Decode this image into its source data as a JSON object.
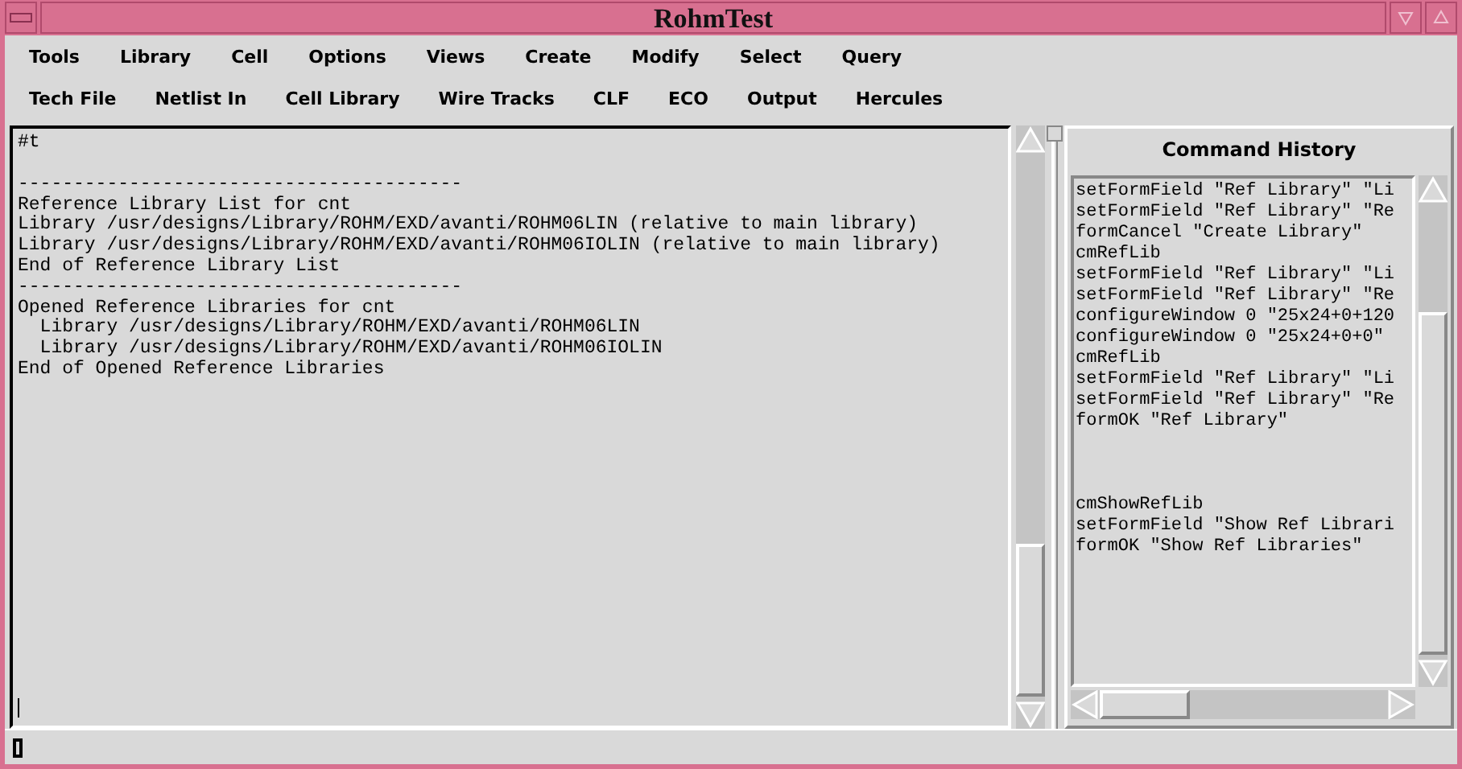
{
  "window": {
    "title": "RohmTest"
  },
  "menus": [
    [
      "Tools",
      "Library",
      "Cell",
      "Options",
      "Views",
      "Create",
      "Modify",
      "Select",
      "Query"
    ],
    [
      "Tech File",
      "Netlist In",
      "Cell Library",
      "Wire Tracks",
      "CLF",
      "ECO",
      "Output",
      "Hercules"
    ]
  ],
  "output": {
    "blocks": [
      [
        "#t"
      ],
      [
        "----------------------------------------",
        "Reference Library List for cnt",
        "Library /usr/designs/Library/ROHM/EXD/avanti/ROHM06LIN (relative to main library)",
        "Library /usr/designs/Library/ROHM/EXD/avanti/ROHM06IOLIN (relative to main library)",
        "End of Reference Library List",
        "----------------------------------------",
        "Opened Reference Libraries for cnt",
        "  Library /usr/designs/Library/ROHM/EXD/avanti/ROHM06LIN",
        "  Library /usr/designs/Library/ROHM/EXD/avanti/ROHM06IOLIN",
        "End of Opened Reference Libraries"
      ]
    ]
  },
  "history": {
    "title": "Command History",
    "blocks": [
      [
        "setFormField \"Ref Library\" \"Li",
        "setFormField \"Ref Library\" \"Re",
        "formCancel \"Create Library\"",
        "cmRefLib",
        "setFormField \"Ref Library\" \"Li",
        "setFormField \"Ref Library\" \"Re",
        "configureWindow 0 \"25x24+0+120",
        "configureWindow 0 \"25x24+0+0\"",
        "cmRefLib",
        "setFormField \"Ref Library\" \"Li",
        "setFormField \"Ref Library\" \"Re",
        "formOK \"Ref Library\""
      ],
      [
        "cmShowRefLib",
        "setFormField \"Show Ref Librari",
        "formOK \"Show Ref Libraries\""
      ]
    ]
  }
}
